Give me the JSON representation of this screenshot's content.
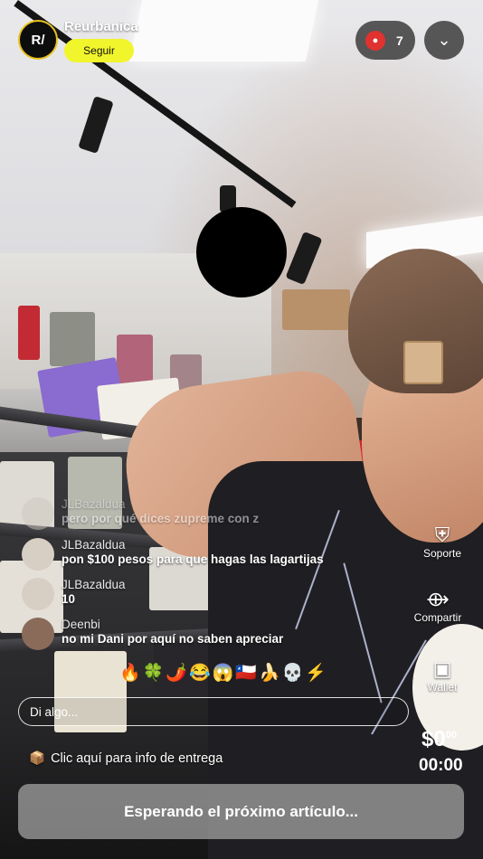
{
  "host": {
    "name": "Reurbanica",
    "avatar_text": "R/",
    "follow_label": "Seguir"
  },
  "viewers": {
    "count": "7",
    "icon": "person-icon"
  },
  "collapse_icon": "chevron-down-icon",
  "chat": [
    {
      "user": "JLBazaldua",
      "message": "pero por qué dices zupreme con z"
    },
    {
      "user": "JLBazaldua",
      "message": "pon $100 pesos para que hagas las lagartijas"
    },
    {
      "user": "JLBazaldua",
      "message": "10"
    },
    {
      "user": "Deenbi",
      "message": "no mi Dani por aquí no saben apreciar"
    }
  ],
  "side_actions": {
    "support": {
      "label": "Soporte",
      "icon": "shield-plus-icon"
    },
    "share": {
      "label": "Compartir",
      "icon": "share-icon"
    },
    "wallet": {
      "label": "Wallet",
      "icon": "wallet-icon"
    }
  },
  "reactions": "🔥🍀🌶️😂😱🇨🇱🍌💀⚡",
  "input": {
    "placeholder": "Di algo..."
  },
  "price": {
    "main": "$0",
    "cents": "00"
  },
  "timer": "00:00",
  "delivery": {
    "icon": "📦",
    "text": "Clic aquí para info de entrega"
  },
  "status_button": "Esperando el próximo artículo..."
}
